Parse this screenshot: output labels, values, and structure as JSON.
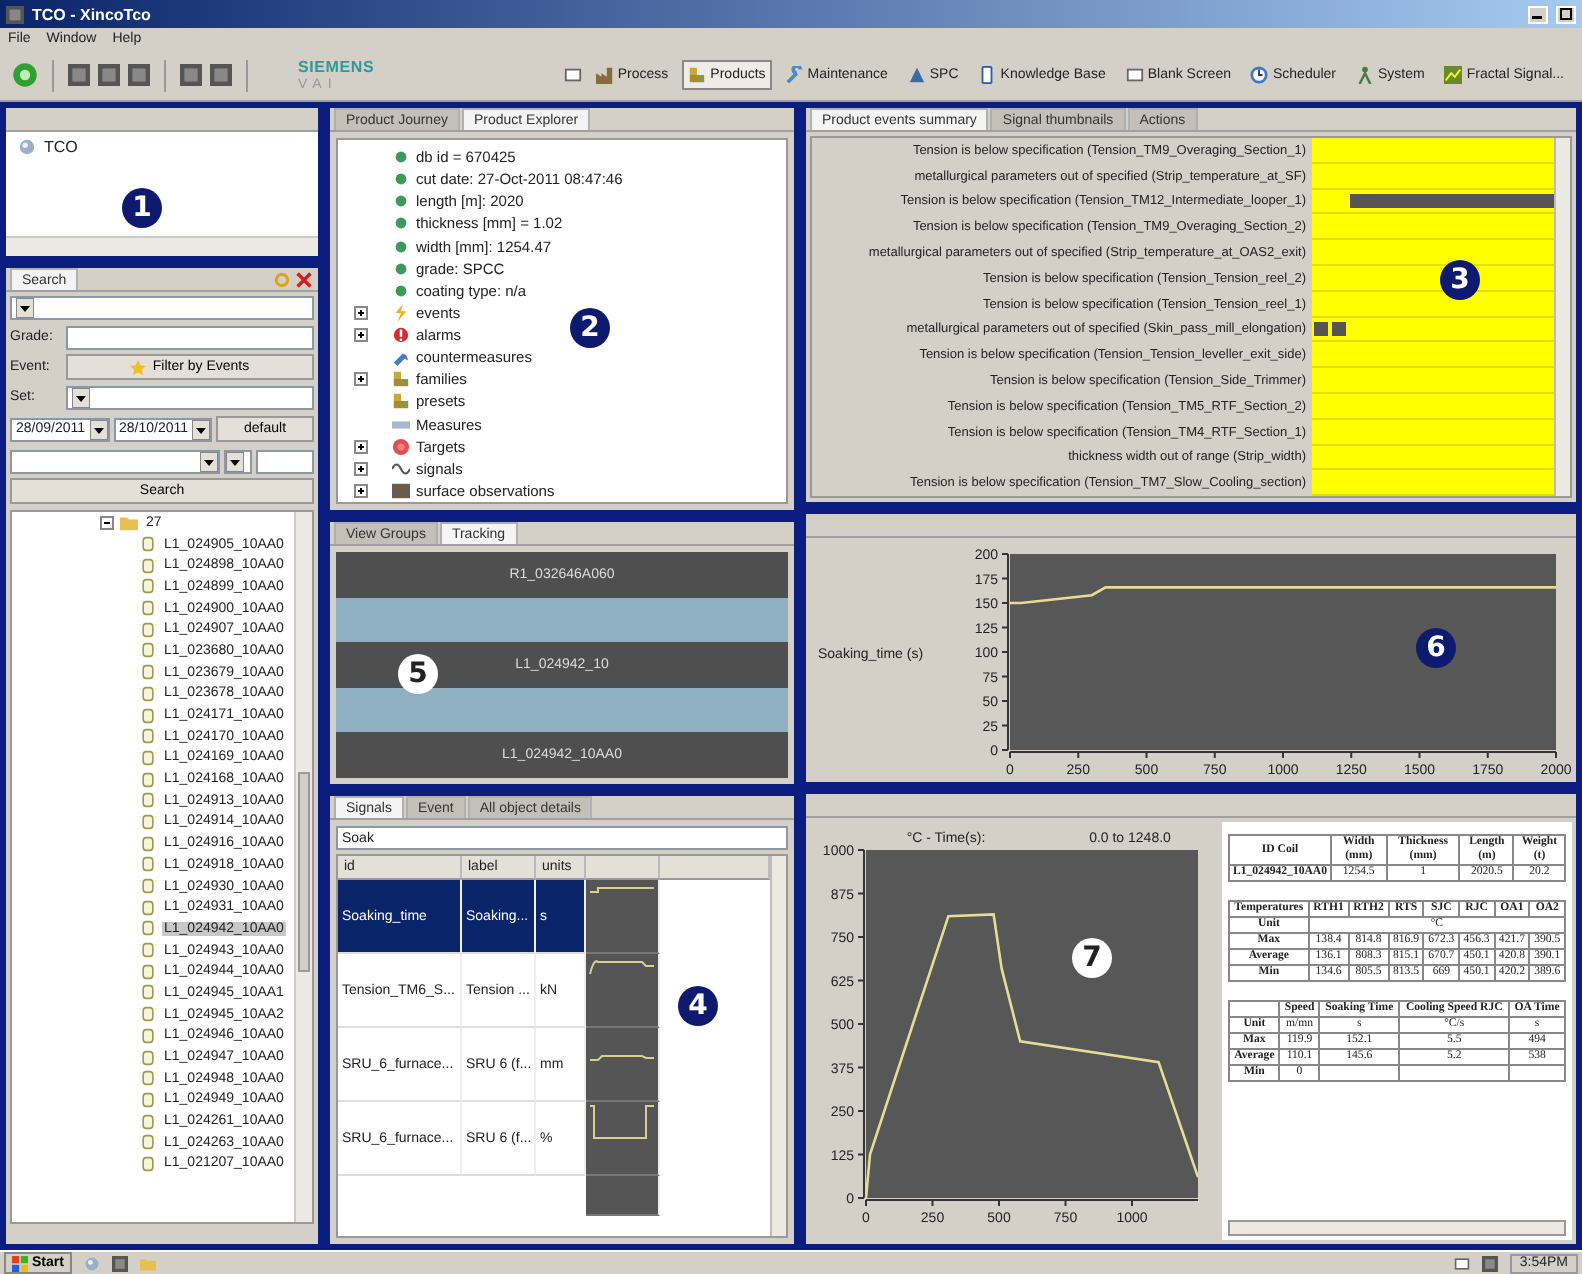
{
  "window": {
    "title": "TCO - XincoTco"
  },
  "menu": [
    "File",
    "Window",
    "Help"
  ],
  "toolbar": {
    "logo": {
      "brand": "SIEMENS",
      "division": "VAI"
    },
    "perspectives": [
      {
        "label": "Process",
        "kind": "factory",
        "selected": false
      },
      {
        "label": "Products",
        "kind": "boxes",
        "selected": true
      },
      {
        "label": "Maintenance",
        "kind": "wrench",
        "selected": false
      },
      {
        "label": "SPC",
        "kind": "triangle",
        "selected": false
      },
      {
        "label": "Knowledge Base",
        "kind": "book",
        "selected": false
      },
      {
        "label": "Blank Screen",
        "kind": "page",
        "selected": false
      },
      {
        "label": "Scheduler",
        "kind": "clock",
        "selected": false
      },
      {
        "label": "System",
        "kind": "figure",
        "selected": false
      },
      {
        "label": "Fractal Signal...",
        "kind": "chart",
        "selected": false
      }
    ]
  },
  "workspace": {
    "callout": {
      "number": "1",
      "kind": "dark"
    },
    "tree": [
      {
        "label": "TCO"
      }
    ]
  },
  "search": {
    "tabs": [
      {
        "label": "Search",
        "selected": true
      }
    ],
    "grade_label": "Grade:",
    "event_label": "Event:",
    "event_button": "Filter by Events",
    "set_label": "Set:",
    "date_from": "28/09/2011",
    "date_to": "28/10/2011",
    "default_button": "default",
    "search_button": "Search",
    "tree": {
      "label": "27",
      "expanded": true,
      "children": [
        {
          "label": "L1_024905_10AA0",
          "selected": false
        },
        {
          "label": "L1_024898_10AA0",
          "selected": false
        },
        {
          "label": "L1_024899_10AA0",
          "selected": false
        },
        {
          "label": "L1_024900_10AA0",
          "selected": false
        },
        {
          "label": "L1_024907_10AA0",
          "selected": false
        },
        {
          "label": "L1_023680_10AA0",
          "selected": false
        },
        {
          "label": "L1_023679_10AA0",
          "selected": false
        },
        {
          "label": "L1_023678_10AA0",
          "selected": false
        },
        {
          "label": "L1_024171_10AA0",
          "selected": false
        },
        {
          "label": "L1_024170_10AA0",
          "selected": false
        },
        {
          "label": "L1_024169_10AA0",
          "selected": false
        },
        {
          "label": "L1_024168_10AA0",
          "selected": false
        },
        {
          "label": "L1_024913_10AA0",
          "selected": false
        },
        {
          "label": "L1_024914_10AA0",
          "selected": false
        },
        {
          "label": "L1_024916_10AA0",
          "selected": false
        },
        {
          "label": "L1_024918_10AA0",
          "selected": false
        },
        {
          "label": "L1_024930_10AA0",
          "selected": false
        },
        {
          "label": "L1_024931_10AA0",
          "selected": false
        },
        {
          "label": "L1_024942_10AA0",
          "selected": true
        },
        {
          "label": "L1_024943_10AA0",
          "selected": false
        },
        {
          "label": "L1_024944_10AA0",
          "selected": false
        },
        {
          "label": "L1_024945_10AA1",
          "selected": false
        },
        {
          "label": "L1_024945_10AA2",
          "selected": false
        },
        {
          "label": "L1_024946_10AA0",
          "selected": false
        },
        {
          "label": "L1_024947_10AA0",
          "selected": false
        },
        {
          "label": "L1_024948_10AA0",
          "selected": false
        },
        {
          "label": "L1_024949_10AA0",
          "selected": false
        },
        {
          "label": "L1_024261_10AA0",
          "selected": false
        },
        {
          "label": "L1_024263_10AA0",
          "selected": false
        },
        {
          "label": "L1_021207_10AA0",
          "selected": false
        }
      ]
    }
  },
  "explorer": {
    "callout": {
      "number": "2",
      "kind": "dark"
    },
    "tabs": [
      {
        "label": "Product Journey",
        "selected": false
      },
      {
        "label": "Product Explorer",
        "selected": true
      }
    ],
    "items": [
      {
        "label": "db id = 670425",
        "kind": "dot",
        "expander": false
      },
      {
        "label": "cut date: 27-Oct-2011 08:47:46",
        "kind": "dot",
        "expander": false
      },
      {
        "label": "length [m]: 2020",
        "kind": "dot",
        "expander": false
      },
      {
        "label": "thickness [mm] = 1.02",
        "kind": "dot",
        "expander": false
      },
      {
        "label": "width [mm]: 1254.47",
        "kind": "dot",
        "expander": false
      },
      {
        "label": "grade: SPCC",
        "kind": "dot",
        "expander": false
      },
      {
        "label": "coating type: n/a",
        "kind": "dot",
        "expander": false
      },
      {
        "label": "events",
        "kind": "bolt",
        "expander": true
      },
      {
        "label": "alarms",
        "kind": "alarm",
        "expander": true
      },
      {
        "label": "countermeasures",
        "kind": "tool",
        "expander": false
      },
      {
        "label": "families",
        "kind": "boxes",
        "expander": true
      },
      {
        "label": "presets",
        "kind": "boxes",
        "expander": false
      },
      {
        "label": "Measures",
        "kind": "ruler",
        "expander": false
      },
      {
        "label": "Targets",
        "kind": "target",
        "expander": true
      },
      {
        "label": "signals",
        "kind": "wave",
        "expander": true
      },
      {
        "label": "surface observations",
        "kind": "square",
        "expander": true
      }
    ]
  },
  "events": {
    "callout": {
      "number": "3",
      "kind": "dark"
    },
    "tabs": [
      {
        "label": "Product events summary",
        "selected": true
      },
      {
        "label": "Signal thumbnails",
        "selected": false
      },
      {
        "label": "Actions",
        "selected": false
      }
    ],
    "rows": [
      {
        "label": "Tension is below specification (Tension_TM9_Overaging_Section_1)",
        "kind": "none"
      },
      {
        "label": "metallurgical parameters out of specified (Strip_temperature_at_SF)",
        "kind": "none"
      },
      {
        "label": "Tension is below specification (Tension_TM12_Intermediate_looper_1)",
        "kind": "long"
      },
      {
        "label": "Tension is below specification (Tension_TM9_Overaging_Section_2)",
        "kind": "none"
      },
      {
        "label": "metallurgical parameters out of specified (Strip_temperature_at_OAS2_exit)",
        "kind": "none"
      },
      {
        "label": "Tension is below specification (Tension_Tension_reel_2)",
        "kind": "none"
      },
      {
        "label": "Tension is below specification (Tension_Tension_reel_1)",
        "kind": "none"
      },
      {
        "label": "metallurgical parameters out of specified (Skin_pass_mill_elongation)",
        "kind": "double"
      },
      {
        "label": "Tension is below specification (Tension_Tension_leveller_exit_side)",
        "kind": "none"
      },
      {
        "label": "Tension is below specification (Tension_Side_Trimmer)",
        "kind": "none"
      },
      {
        "label": "Tension is below specification (Tension_TM5_RTF_Section_2)",
        "kind": "none"
      },
      {
        "label": "Tension is below specification (Tension_TM4_RTF_Section_1)",
        "kind": "none"
      },
      {
        "label": "thickness width out of range (Strip_width)",
        "kind": "none"
      },
      {
        "label": "Tension is below specification (Tension_TM7_Slow_Cooling_section)",
        "kind": "none"
      }
    ]
  },
  "tracking": {
    "callout": {
      "number": "5",
      "kind": "light"
    },
    "tabs": [
      {
        "label": "View Groups",
        "selected": false
      },
      {
        "label": "Tracking",
        "selected": true
      }
    ],
    "bars": [
      {
        "kind": "coil",
        "label": "R1_032646A060"
      },
      {
        "kind": "gap"
      },
      {
        "kind": "coil",
        "label": "L1_024942_10"
      },
      {
        "kind": "gap"
      },
      {
        "kind": "coil",
        "label": "L1_024942_10AA0"
      }
    ]
  },
  "signals": {
    "callout": {
      "number": "4",
      "kind": "dark"
    },
    "tabs": [
      {
        "label": "Signals",
        "selected": true
      },
      {
        "label": "Event",
        "selected": false
      },
      {
        "label": "All object details",
        "selected": false
      }
    ],
    "filter": "Soak",
    "columns": [
      "id",
      "label",
      "units"
    ],
    "rows": [
      {
        "id": "Soaking_time",
        "label": "Soaking...",
        "units": "s",
        "selected": true
      },
      {
        "id": "Tension_TM6_S...",
        "label": "Tension ...",
        "units": "kN",
        "selected": false
      },
      {
        "id": "SRU_6_furnace...",
        "label": "SRU 6 (f...",
        "units": "mm",
        "selected": false
      },
      {
        "id": "SRU_6_furnace...",
        "label": "SRU 6 (f...",
        "units": "%",
        "selected": false
      }
    ]
  },
  "trend": {
    "callout": {
      "number": "6",
      "kind": "dark"
    },
    "chart_data": {
      "type": "line",
      "ylabel": "Soaking_time (s)",
      "x": [
        0,
        40,
        300,
        350,
        2000
      ],
      "series": [
        {
          "color": "#e6dc96",
          "values": [
            150,
            150,
            158,
            166,
            166
          ]
        }
      ],
      "xlim": [
        0,
        2000
      ],
      "ylim": [
        0,
        200
      ],
      "xticks": [
        0,
        250,
        500,
        750,
        1000,
        1250,
        1500,
        1750,
        2000
      ],
      "yticks": [
        0,
        25,
        50,
        75,
        100,
        125,
        150,
        175,
        200
      ]
    }
  },
  "cycle": {
    "callout": {
      "number": "7",
      "kind": "light"
    },
    "range_label": "0.0 to 1248.0",
    "chart_data": {
      "type": "line",
      "title": "°C - Time(s):",
      "x": [
        0,
        15,
        310,
        480,
        510,
        580,
        1100,
        1248
      ],
      "series": [
        {
          "color": "#e6dc96",
          "values": [
            0,
            125,
            810,
            815,
            660,
            450,
            390,
            60
          ]
        }
      ],
      "xlim": [
        0,
        1248
      ],
      "ylim": [
        0,
        1000
      ],
      "xticks": [
        0,
        250,
        500,
        750,
        1000
      ],
      "yticks": [
        0,
        125,
        250,
        375,
        500,
        625,
        750,
        875,
        1000
      ]
    },
    "tables": [
      {
        "columns": [
          "ID Coil",
          "Width (mm)",
          "Thickness (mm)",
          "Length (m)",
          "Weight (t)"
        ],
        "rows": [
          [
            "L1_024942_10AA0",
            "1254.5",
            "1",
            "2020.5",
            "20.2"
          ]
        ]
      },
      {
        "columns": [
          "Temperatures",
          "RTH1",
          "RTH2",
          "RTS",
          "SJC",
          "RJC",
          "OA1",
          "OA2"
        ],
        "rows": [
          [
            "Unit",
            {
              "text": "°C",
              "colspan": 7
            }
          ],
          [
            "Max",
            "138.4",
            "814.8",
            "816.9",
            "672.3",
            "456.3",
            "421.7",
            "390.5"
          ],
          [
            "Average",
            "136.1",
            "808.3",
            "815.1",
            "670.7",
            "450.1",
            "420.8",
            "390.1"
          ],
          [
            "Min",
            "134.6",
            "805.5",
            "813.5",
            "669",
            "450.1",
            "420.2",
            "389.6"
          ]
        ]
      },
      {
        "columns": [
          "",
          "Speed",
          "Soaking Time",
          "Cooling Speed RJC",
          "OA Time"
        ],
        "rows": [
          [
            "Unit",
            "m/mn",
            "s",
            "°C/s",
            "s"
          ],
          [
            "Max",
            "119.9",
            "152.1",
            "5.5",
            "494"
          ],
          [
            "Average",
            "110.1",
            "145.6",
            "5.2",
            "538"
          ],
          [
            "Min",
            "0",
            "",
            "",
            ""
          ]
        ]
      }
    ]
  },
  "taskbar": {
    "start": "Start",
    "clock": "3:54PM"
  }
}
